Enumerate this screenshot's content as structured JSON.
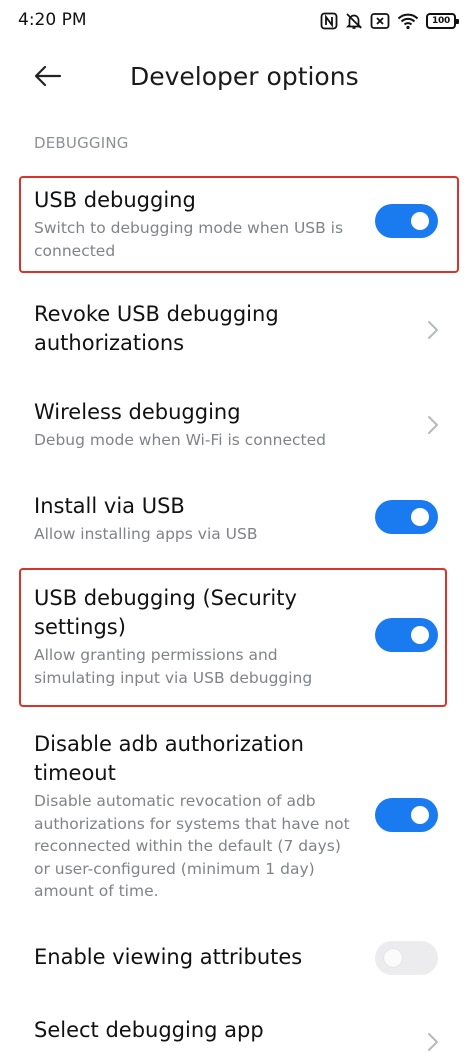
{
  "status_bar": {
    "time": "4:20 PM",
    "battery": "100",
    "icons": [
      "nfc-icon",
      "bell-muted-icon",
      "sim-x-icon",
      "wifi-icon",
      "battery-icon"
    ]
  },
  "header": {
    "title": "Developer options",
    "back_icon": "arrow-left-icon"
  },
  "section": {
    "label": "DEBUGGING"
  },
  "items": [
    {
      "title": "USB debugging",
      "subtitle": "Switch to debugging mode when USB is connected",
      "control": "toggle",
      "on": true,
      "highlighted": true
    },
    {
      "title": "Revoke USB debugging authorizations",
      "subtitle": "",
      "control": "chevron"
    },
    {
      "title": "Wireless debugging",
      "subtitle": "Debug mode when Wi-Fi is connected",
      "control": "chevron"
    },
    {
      "title": "Install via USB",
      "subtitle": "Allow installing apps via USB",
      "control": "toggle",
      "on": true
    },
    {
      "title": "USB debugging (Security settings)",
      "subtitle": "Allow granting permissions and simulating input via USB debugging",
      "control": "toggle",
      "on": true,
      "highlighted": true
    },
    {
      "title": "Disable adb authorization timeout",
      "subtitle": "Disable automatic revocation of adb authorizations for systems that have not reconnected within the default (7 days) or user-configured (minimum 1 day) amount of time.",
      "control": "toggle",
      "on": true
    },
    {
      "title": "Enable viewing attributes",
      "subtitle": "",
      "control": "toggle",
      "on": false
    },
    {
      "title": "Select debugging app",
      "subtitle": "",
      "control": "chevron"
    }
  ],
  "colors": {
    "accent": "#1a7bf0",
    "highlight": "#d9342b",
    "secondary_text": "#808389"
  }
}
